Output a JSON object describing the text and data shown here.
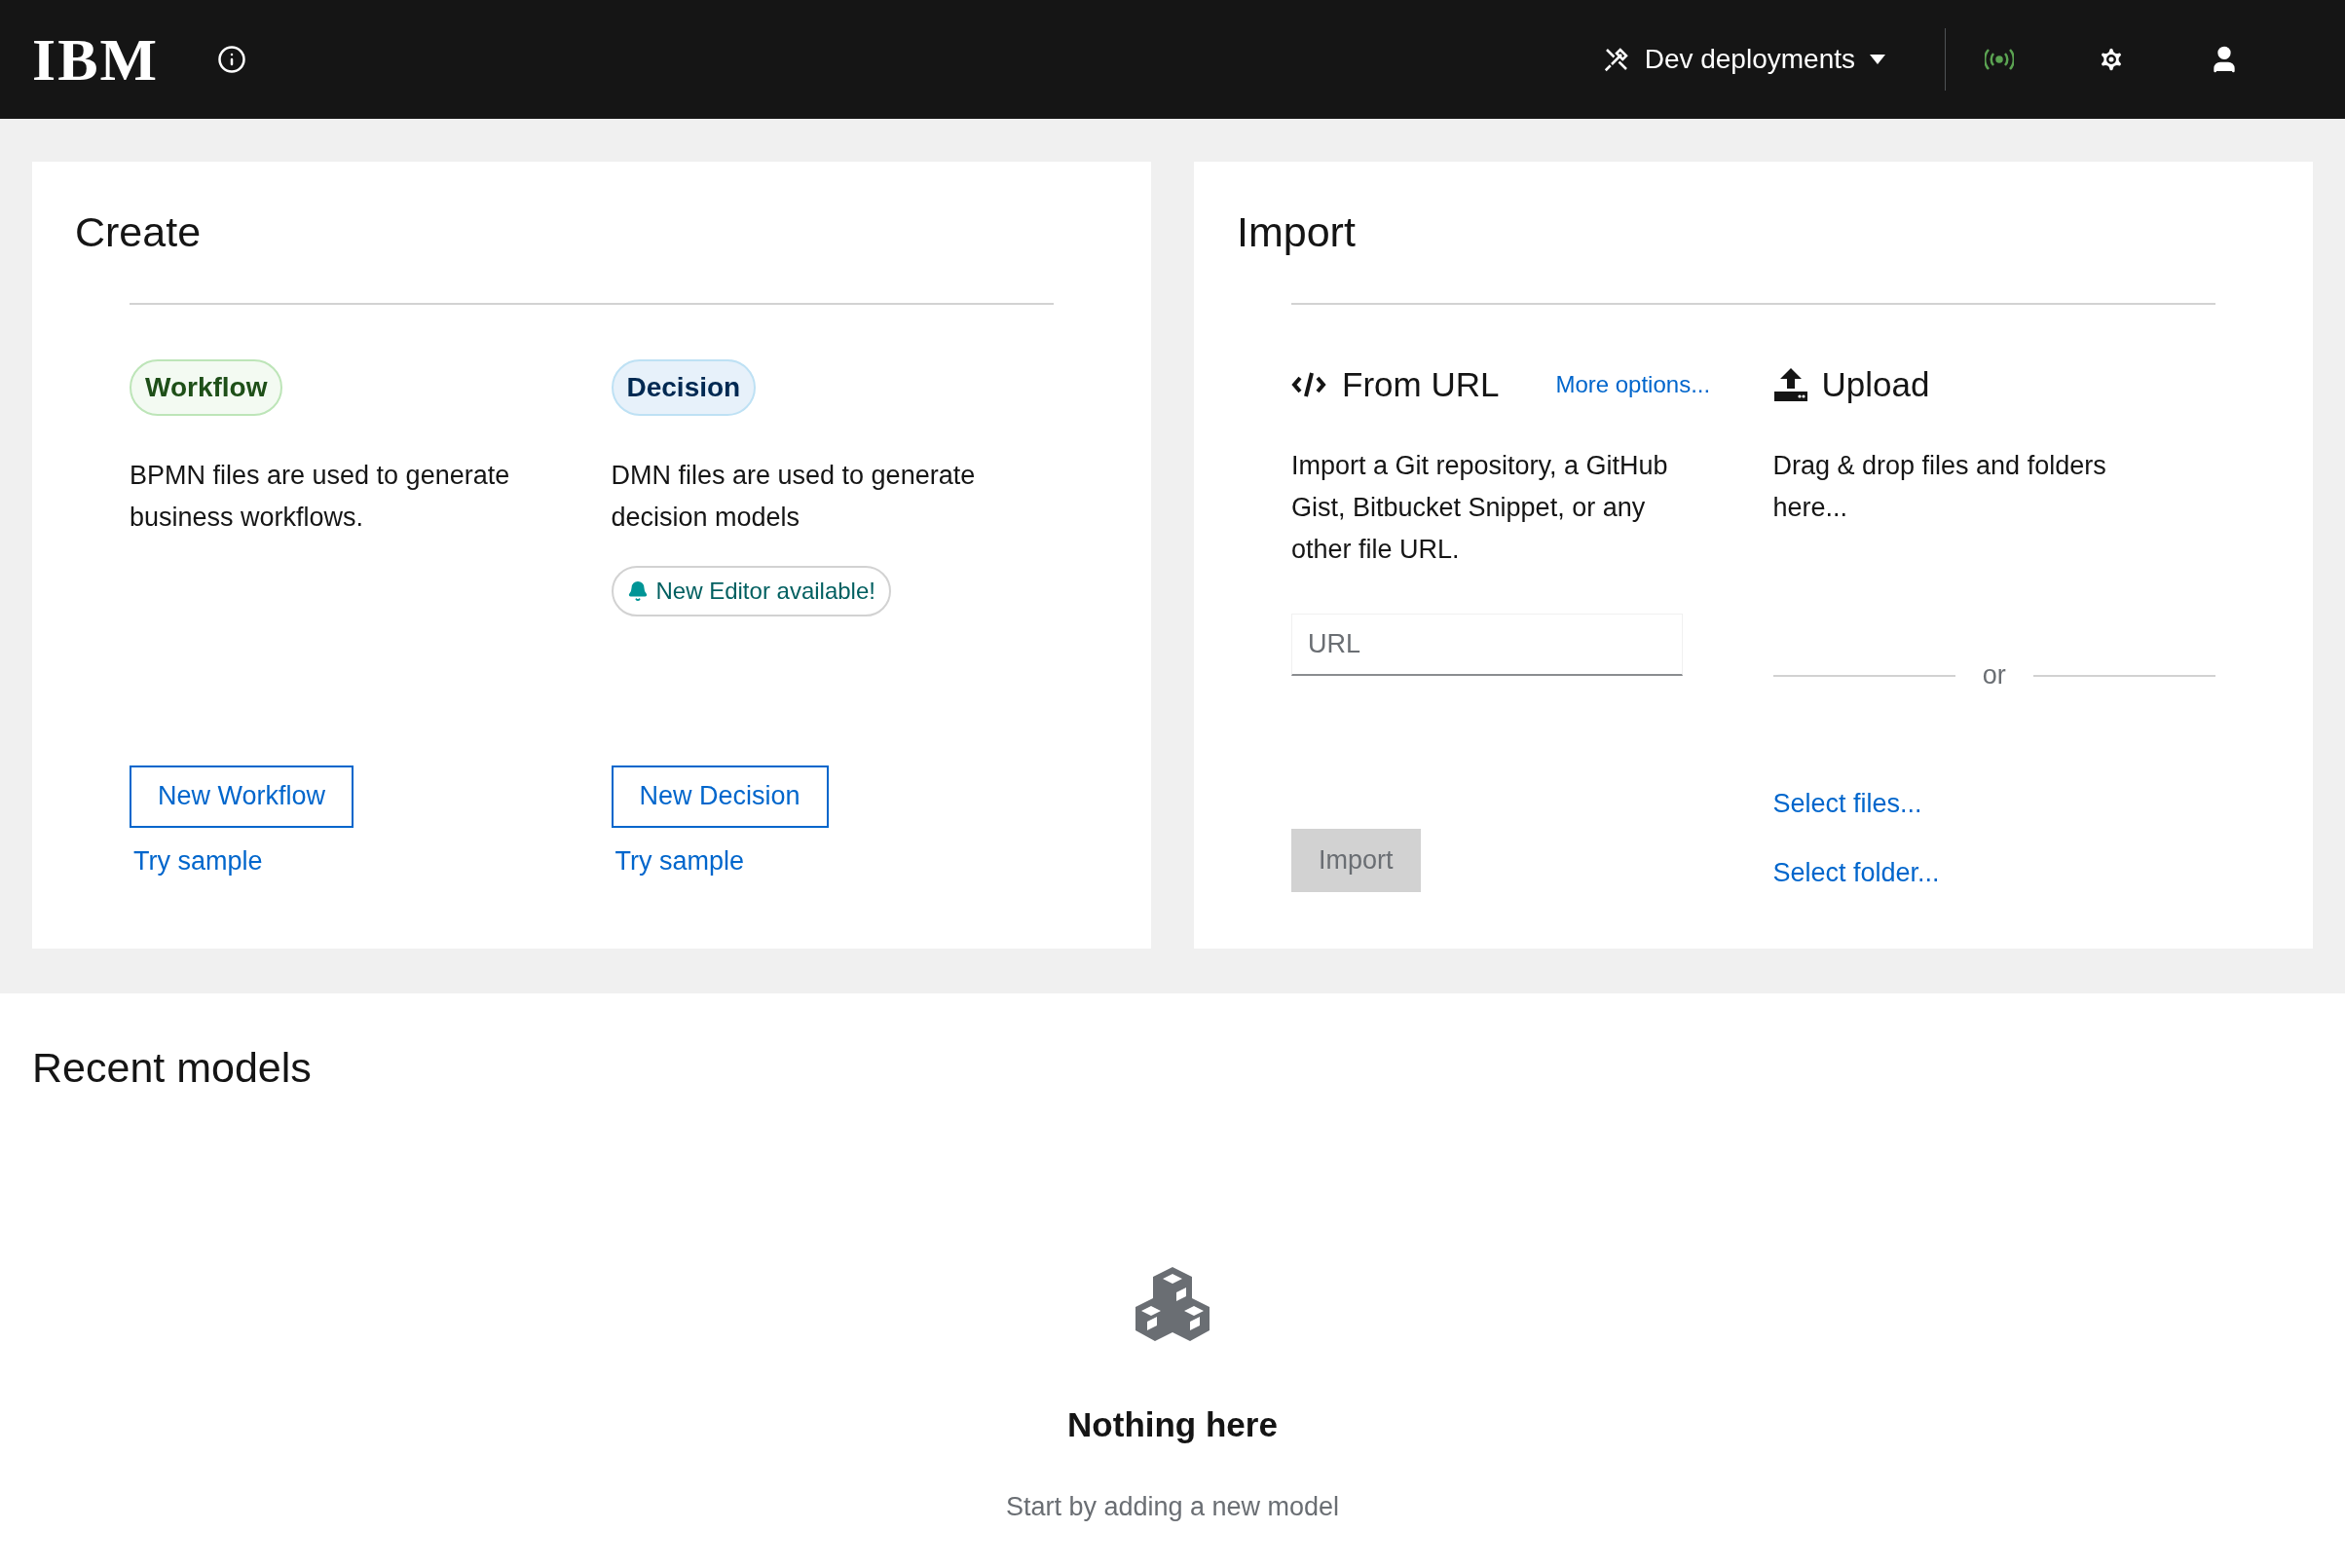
{
  "header": {
    "logo": "IBM",
    "deployments": "Dev deployments"
  },
  "create": {
    "title": "Create",
    "columns": [
      {
        "tag": "Workflow",
        "kind": "workflow",
        "description": "BPMN files are used to generate business workflows.",
        "button": "New Workflow",
        "link": "Try sample"
      },
      {
        "tag": "Decision",
        "kind": "decision",
        "description": "DMN files are used to generate decision models",
        "notice": "New Editor available!",
        "button": "New Decision",
        "link": "Try sample"
      }
    ]
  },
  "import": {
    "title": "Import",
    "from_url": {
      "title": "From URL",
      "more_options": "More options...",
      "description": "Import a Git repository, a GitHub Gist, Bitbucket Snippet, or any other file URL.",
      "url_field": {
        "placeholder": "URL"
      },
      "import_button": {
        "label": "Import",
        "disabled": true
      }
    },
    "upload": {
      "title": "Upload",
      "description": "Drag & drop files and folders here...",
      "separator": "or",
      "links": [
        "Select files...",
        "Select folder..."
      ]
    }
  },
  "recent": {
    "title": "Recent models",
    "empty": {
      "title": "Nothing here",
      "subtitle": "Start by adding a new model"
    }
  }
}
